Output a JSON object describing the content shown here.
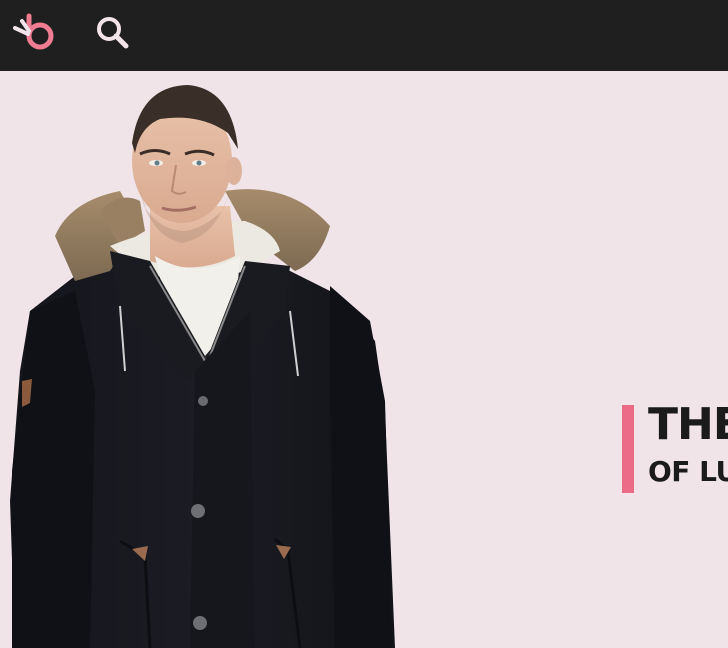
{
  "navbar": {
    "logo_icon": "brand-logo-icon",
    "search_icon": "search-icon"
  },
  "hero": {
    "headline": "THE",
    "subheadline": "OF LU",
    "accent_color": "#ec6b86"
  },
  "colors": {
    "navbar_bg": "#1f1f1f",
    "hero_bg": "#f0e4e8",
    "logo_pink": "#f07c92",
    "icon_light": "#f3e4e9",
    "text_dark": "#1b1b1b"
  }
}
